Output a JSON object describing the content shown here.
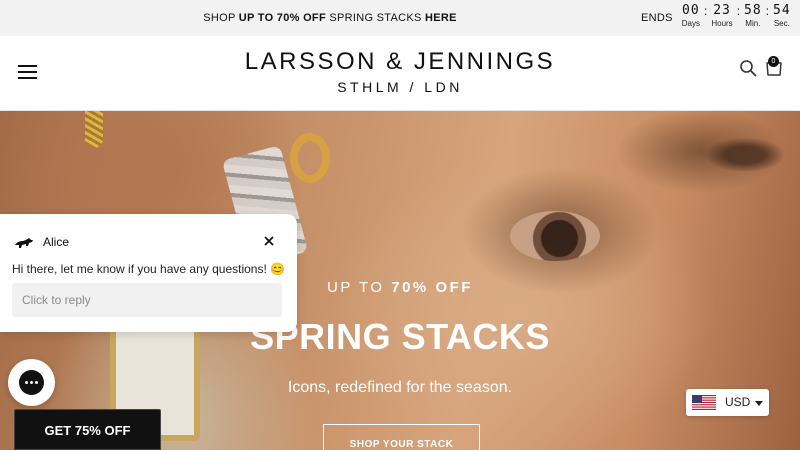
{
  "announcement": {
    "prefix": "SHOP ",
    "highlight": "UP TO 70% OFF",
    "middle": " SPRING STACKS ",
    "suffix": "HERE"
  },
  "countdown": {
    "ends_label": "ENDS",
    "units": [
      {
        "value": "00",
        "label": "Days"
      },
      {
        "value": "23",
        "label": "Hours"
      },
      {
        "value": "58",
        "label": "Min."
      },
      {
        "value": "54",
        "label": "Sec."
      }
    ]
  },
  "header": {
    "logo_main": "LARSSON & JENNINGS",
    "logo_sub": "STHLM / LDN",
    "cart_count": "0",
    "menu_icon": "hamburger-menu-icon",
    "search_icon": "search-icon",
    "cart_icon": "shopping-bag-icon"
  },
  "hero": {
    "kicker_prefix": "UP TO ",
    "kicker_highlight": "70% OFF",
    "title": "SPRING STACKS",
    "subtitle": "Icons, redefined for the season.",
    "cta": "SHOP YOUR STACK"
  },
  "chat": {
    "agent_name": "Alice",
    "message": "Hi there, let me know if you have any questions! 😊",
    "placeholder": "Click to reply"
  },
  "promo_button": "GET 75% OFF",
  "currency": {
    "code": "USD"
  },
  "colors": {
    "announcement_bg": "#f2f2f2",
    "dark": "#111111",
    "white": "#ffffff"
  }
}
